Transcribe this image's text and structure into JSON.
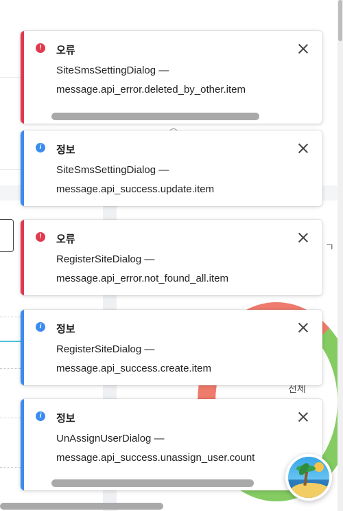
{
  "background": {
    "partial_text_right": "ㄱ",
    "partial_text_bottom": "전체",
    "colors": {
      "chart_line": "#4cc3d9",
      "donut_red": "#ee7b6c",
      "donut_green": "#84cc62"
    }
  },
  "toasts": [
    {
      "type": "error",
      "title": "오류",
      "source": "SiteSmsSettingDialog —",
      "message": "message.api_error.deleted_by_other.item"
    },
    {
      "type": "info",
      "title": "정보",
      "source": "SiteSmsSettingDialog —",
      "message": "message.api_success.update.item"
    },
    {
      "type": "error",
      "title": "오류",
      "source": "RegisterSiteDialog —",
      "message": "message.api_error.not_found_all.item"
    },
    {
      "type": "info",
      "title": "정보",
      "source": "RegisterSiteDialog —",
      "message": "message.api_success.create.item"
    },
    {
      "type": "info",
      "title": "정보",
      "source": "UnAssignUserDialog —",
      "message": "message.api_success.unassign_user.count"
    }
  ],
  "icons": {
    "error": "!",
    "info": "i",
    "close": "close-icon",
    "fab": "beach-palm-icon"
  },
  "colors": {
    "error": "#e03a4f",
    "info": "#3c8cf0"
  }
}
